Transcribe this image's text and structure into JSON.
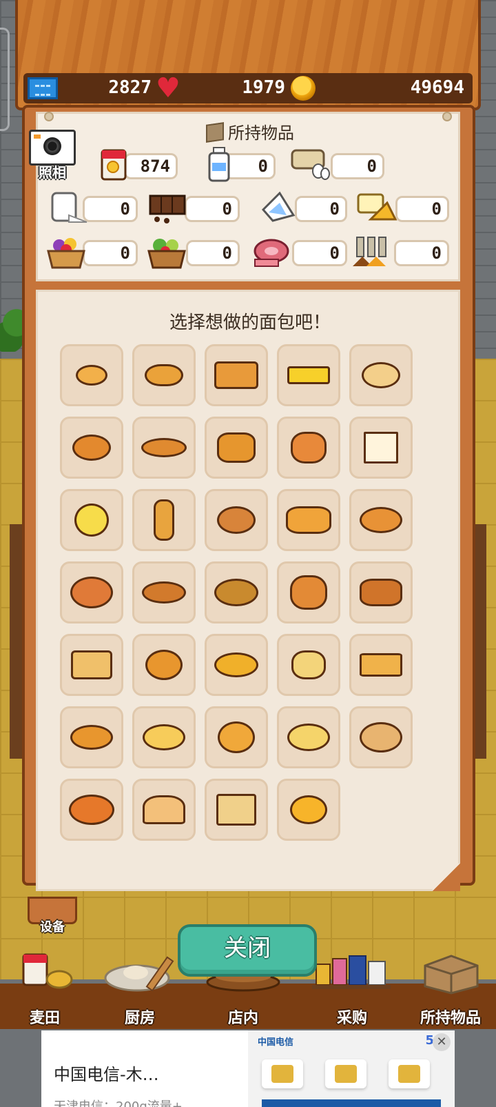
{
  "stats": {
    "tickets": "2827",
    "hearts": "1979",
    "coins": "49694"
  },
  "camera": {
    "label": "照相"
  },
  "inventory": {
    "title": "所持物品",
    "items": [
      {
        "name": "flour-bag",
        "count": "874"
      },
      {
        "name": "milk",
        "count": "0"
      },
      {
        "name": "eggs",
        "count": "0"
      },
      {
        "name": "sugar",
        "count": "0"
      },
      {
        "name": "chocolate",
        "count": "0"
      },
      {
        "name": "cream",
        "count": "0"
      },
      {
        "name": "butter-cheese",
        "count": "0"
      },
      {
        "name": "fruit-basket",
        "count": "0"
      },
      {
        "name": "vegetable-basket",
        "count": "0"
      },
      {
        "name": "meat",
        "count": "0"
      },
      {
        "name": "spices",
        "count": "0"
      }
    ]
  },
  "bread_panel": {
    "title": "选择想做的面包吧！",
    "breads": [
      "small-roll",
      "butter-roll",
      "loaf",
      "castella",
      "bagel",
      "donut",
      "croissant",
      "melon-bread",
      "bunny-bread",
      "sandwich",
      "muffin",
      "baguette",
      "sprinkle-donut",
      "pastry",
      "bun",
      "jam-danish",
      "chocolate-cornet",
      "curry-bread",
      "bear-bread",
      "chocolate-roll",
      "french-toast",
      "pie",
      "cream-roll",
      "burger",
      "waffle",
      "coppe-bread",
      "round-bread",
      "cream-bun",
      "cheese-bread",
      "ring-bread",
      "pizza-bread",
      "kouglof",
      "toast-slices",
      "anpan"
    ]
  },
  "buttons": {
    "equipment": "设备",
    "close": "关闭"
  },
  "nav": {
    "wheat_field": "麦田",
    "kitchen": "厨房",
    "shop": "店内",
    "purchase": "采购",
    "inventory": "所持物品"
  },
  "ad": {
    "title": "中国电信-木…",
    "subtitle": "天津电信：200g流量+…",
    "brand": "中国电信",
    "countdown": "5"
  },
  "colors": {
    "accent_teal": "#49bda2",
    "wood": "#c6743a",
    "panel": "#f2e8db"
  }
}
